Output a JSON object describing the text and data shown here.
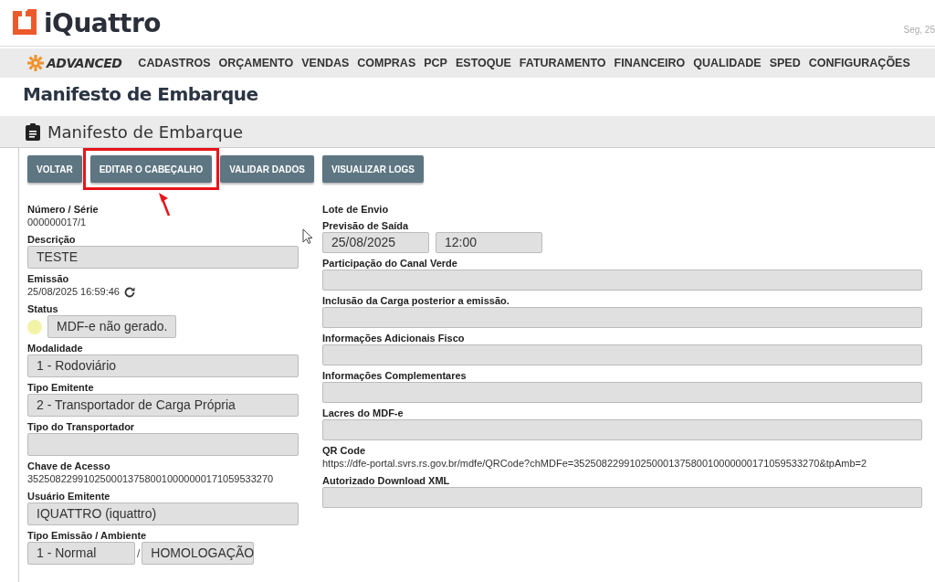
{
  "header": {
    "brand": "iQuattro",
    "date": "Seg, 25"
  },
  "nav": {
    "brand": "ADVANCED",
    "items": [
      "CADASTROS",
      "ORÇAMENTO",
      "VENDAS",
      "COMPRAS",
      "PCP",
      "ESTOQUE",
      "FATURAMENTO",
      "FINANCEIRO",
      "QUALIDADE",
      "SPED",
      "CONFIGURAÇÕES"
    ]
  },
  "page_title": "Manifesto de Embarque",
  "panel": {
    "title": "Manifesto de Embarque",
    "buttons": [
      {
        "label": "VOLTAR",
        "highlighted": false
      },
      {
        "label": "EDITAR O CABEÇALHO",
        "highlighted": true
      },
      {
        "label": "VALIDAR DADOS",
        "highlighted": false
      },
      {
        "label": "VISUALIZAR LOGS",
        "highlighted": false
      }
    ],
    "left_fields": [
      {
        "kind": "text",
        "label": "Número / Série",
        "value": "000000017/1"
      },
      {
        "kind": "input",
        "label": "Descrição",
        "value": "TESTE"
      },
      {
        "kind": "refresh",
        "label": "Emissão",
        "value": "25/08/2025 16:59:46"
      },
      {
        "kind": "status",
        "label": "Status",
        "value": "MDF-e não gerado.",
        "color": "#f3f3a8"
      },
      {
        "kind": "input",
        "label": "Modalidade",
        "value": "1 - Rodoviário"
      },
      {
        "kind": "input",
        "label": "Tipo Emitente",
        "value": "2 - Transportador de Carga Própria"
      },
      {
        "kind": "input",
        "label": "Tipo do Transportador"
      },
      {
        "kind": "text",
        "label": "Chave de Acesso",
        "value": "35250822991025000137580010000000171059533270"
      },
      {
        "kind": "input",
        "label": "Usuário Emitente",
        "value": "IQUATTRO (iquattro)"
      },
      {
        "kind": "pair",
        "label": "Tipo Emissão / Ambiente",
        "values": [
          "1 - Normal",
          "HOMOLOGAÇÃO"
        ],
        "separator": "/"
      }
    ],
    "right_fields": [
      {
        "kind": "text",
        "label": "Lote de Envio"
      },
      {
        "kind": "pair",
        "label": "Previsão de Saída",
        "values": [
          "25/08/2025",
          "12:00"
        ]
      },
      {
        "kind": "input",
        "label": "Participação do Canal Verde"
      },
      {
        "kind": "input",
        "label": "Inclusão da Carga posterior a emissão."
      },
      {
        "kind": "input",
        "label": "Informações Adicionais Fisco"
      },
      {
        "kind": "input",
        "label": "Informações Complementares"
      },
      {
        "kind": "input",
        "label": "Lacres do MDF-e"
      },
      {
        "kind": "text",
        "label": "QR Code",
        "value": "https://dfe-portal.svrs.rs.gov.br/mdfe/QRCode?chMDFe=35250822991025000137580010000000171059533270&tpAmb=2"
      },
      {
        "kind": "input",
        "label": "Autorizado Download XML"
      }
    ]
  }
}
